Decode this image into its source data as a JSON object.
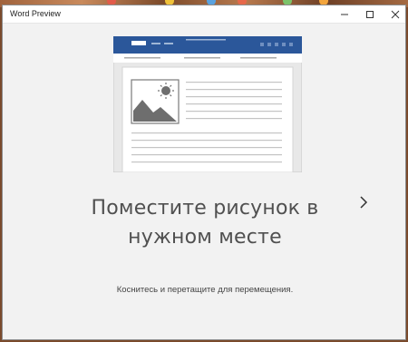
{
  "window": {
    "title": "Word Preview",
    "controls": [
      "minimize-icon",
      "maximize-icon",
      "close-icon"
    ]
  },
  "slide": {
    "heading_line1": "Поместите рисунок в",
    "heading_line2": "нужном месте",
    "subtext": "Коснитесь и перетащите для перемещения."
  },
  "colors": {
    "ribbon": "#2b579a",
    "background": "#f2f2f2",
    "picture_fill": "#6e6e6e"
  },
  "icons": {
    "next": "chevron-right-icon",
    "illustration": "document-with-picture-illustration"
  }
}
